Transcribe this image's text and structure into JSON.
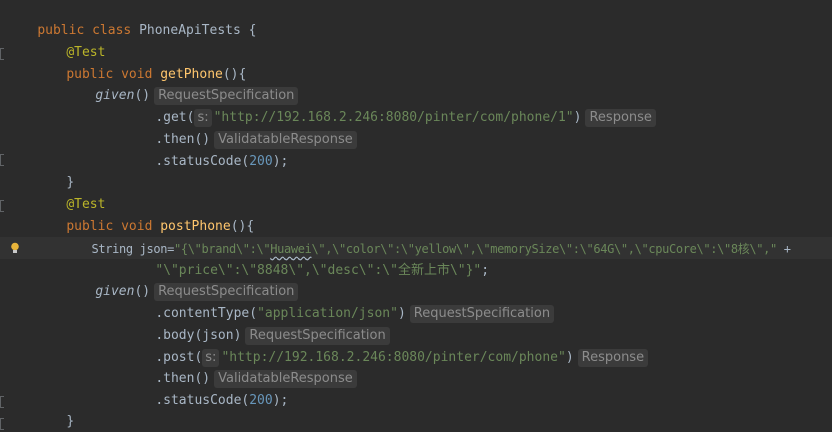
{
  "editor": {
    "line1": {
      "kw": "public class ",
      "cls": "PhoneApiTests",
      "rest": " {"
    },
    "line2": {
      "ann": "@Test"
    },
    "line3": {
      "kw": "public void ",
      "fn": "getPhone",
      "rest": "(){"
    },
    "line4": {
      "call": "given",
      "rest": "()",
      "hint": "RequestSpecification"
    },
    "line5": {
      "pre": ".get(",
      "param_hint": "s:",
      "str": "\"http://192.168.2.246:8080/pinter/com/phone/1\"",
      "post": ")",
      "hint": "Response"
    },
    "line6": {
      "pre": ".then()",
      "hint": "ValidatableResponse"
    },
    "line7": {
      "pre": ".statusCode(",
      "num": "200",
      "post": ");"
    },
    "line8": {
      "rest": "}"
    },
    "line9": {
      "ann": "@Test"
    },
    "line10": {
      "kw": "public void ",
      "fn": "postPhone",
      "rest": "(){"
    },
    "line11": {
      "type": "String json=",
      "str_a": "\"{\\\"brand\\\":\\\"",
      "wavy": "Huawei",
      "str_b": "\\\",\\\"color\\\":\\\"yellow\\\",\\\"memorySize\\\":\\\"64G\\\",\\\"cpuCore\\\":\\\"8核\\\",\"",
      "plus": " +"
    },
    "line12": {
      "str": "\"\\\"price\\\":\\\"8848\\\",\\\"desc\\\":\\\"全新上市\\\"}\"",
      "post": ";"
    },
    "line13": {
      "call": "given",
      "rest": "()",
      "hint": "RequestSpecification"
    },
    "line14": {
      "pre": ".contentType(",
      "str": "\"application/json\"",
      "post": ")",
      "hint": "RequestSpecification"
    },
    "line15": {
      "pre": ".body(json)",
      "hint": "RequestSpecification"
    },
    "line16": {
      "pre": ".post(",
      "param_hint": "s:",
      "str": "\"http://192.168.2.246:8080/pinter/com/phone\"",
      "post": ")",
      "hint": "Response"
    },
    "line17": {
      "pre": ".then()",
      "hint": "ValidatableResponse"
    },
    "line18": {
      "pre": ".statusCode(",
      "num": "200",
      "post": ");"
    },
    "line19": {
      "rest": "}"
    },
    "line20": {
      "rest": "}"
    }
  },
  "colors": {
    "background": "#2b2b2b",
    "keyword": "#cc7832",
    "annotation": "#bbb529",
    "method": "#ffc66d",
    "string": "#6a8759",
    "number": "#6897bb",
    "text": "#a9b7c6",
    "hint": "#8c8c8c"
  },
  "icons": [
    "lightbulb-icon",
    "fold-marker-icon"
  ]
}
